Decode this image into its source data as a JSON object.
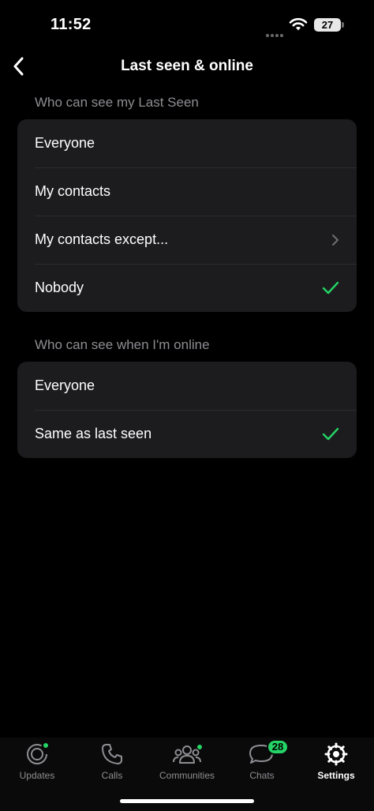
{
  "status_bar": {
    "time": "11:52",
    "battery": "27"
  },
  "header": {
    "title": "Last seen & online"
  },
  "last_seen": {
    "section_title": "Who can see my Last Seen",
    "options": [
      {
        "label": "Everyone",
        "selected": false
      },
      {
        "label": "My contacts",
        "selected": false
      },
      {
        "label": "My contacts except...",
        "selected": false,
        "has_chevron": true
      },
      {
        "label": "Nobody",
        "selected": true
      }
    ]
  },
  "online": {
    "section_title": "Who can see when I'm online",
    "options": [
      {
        "label": "Everyone",
        "selected": false
      },
      {
        "label": "Same as last seen",
        "selected": true
      }
    ]
  },
  "tab_bar": {
    "tabs": [
      {
        "label": "Updates",
        "icon": "updates-icon",
        "dot": true
      },
      {
        "label": "Calls",
        "icon": "phone-icon"
      },
      {
        "label": "Communities",
        "icon": "communities-icon",
        "dot": true
      },
      {
        "label": "Chats",
        "icon": "chats-icon",
        "badge": "28"
      },
      {
        "label": "Settings",
        "icon": "gear-icon",
        "active": true
      }
    ]
  },
  "colors": {
    "accent": "#25d366",
    "background": "#000000",
    "group": "#1c1c1e",
    "secondary_text": "#8e8e93"
  }
}
